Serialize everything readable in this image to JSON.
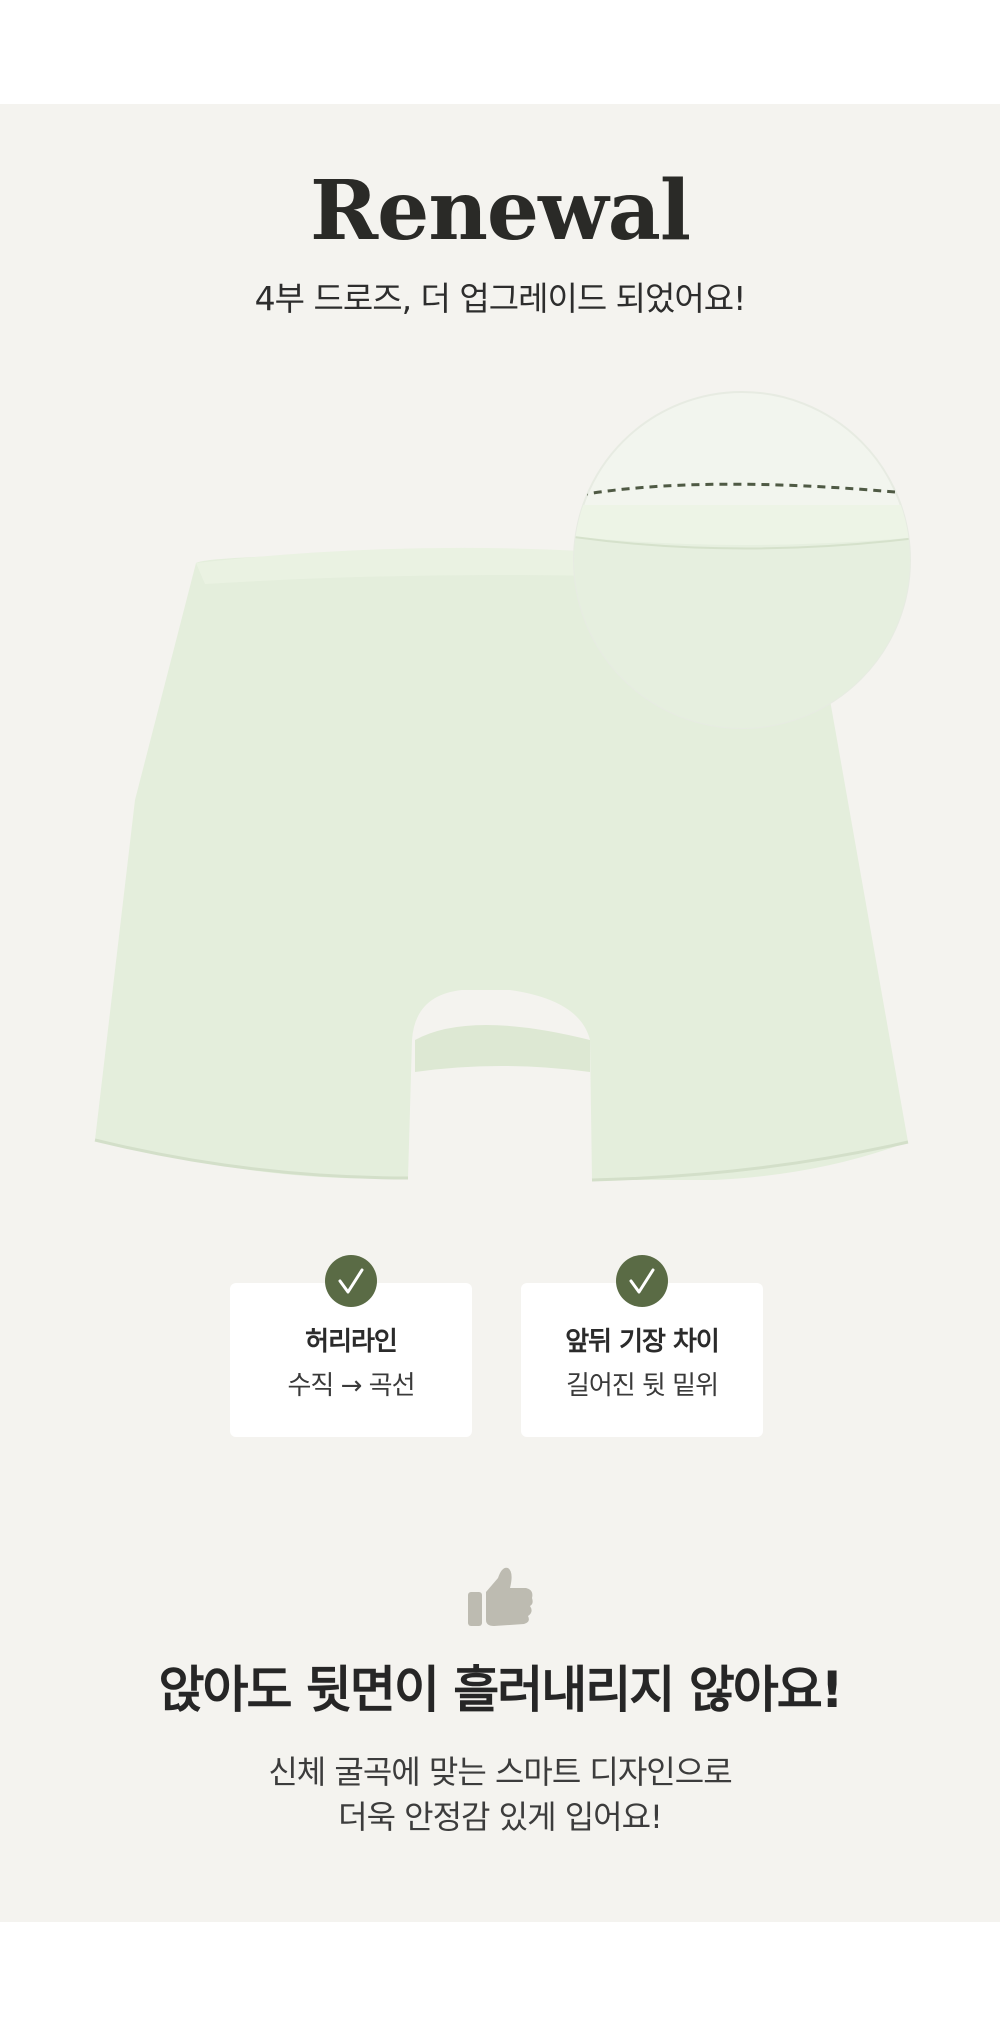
{
  "hero": {
    "title": "Renewal",
    "subtitle": "4부 드로즈, 더 업그레이드 되었어요!"
  },
  "product": {
    "image_icon": "pastel-green-shorts-image",
    "zoom_icon": "waistline-zoom-detail",
    "color": "#e4eedc"
  },
  "features": [
    {
      "icon": "check-icon",
      "title": "허리라인",
      "desc": "수직 → 곡선"
    },
    {
      "icon": "check-icon",
      "title": "앞뒤 기장 차이",
      "desc": "길어진 뒷 밑위"
    }
  ],
  "benefit": {
    "icon": "thumbs-up-icon",
    "headline": "앉아도 뒷면이 흘러내리지 않아요!",
    "line1": "신체 굴곡에 맞는 스마트 디자인으로",
    "line2": "더욱 안정감 있게 입어요!"
  },
  "colors": {
    "panel_bg": "#f4f3ef",
    "accent_green": "#5a6b45",
    "thumb_gray": "#bdbbb1"
  }
}
